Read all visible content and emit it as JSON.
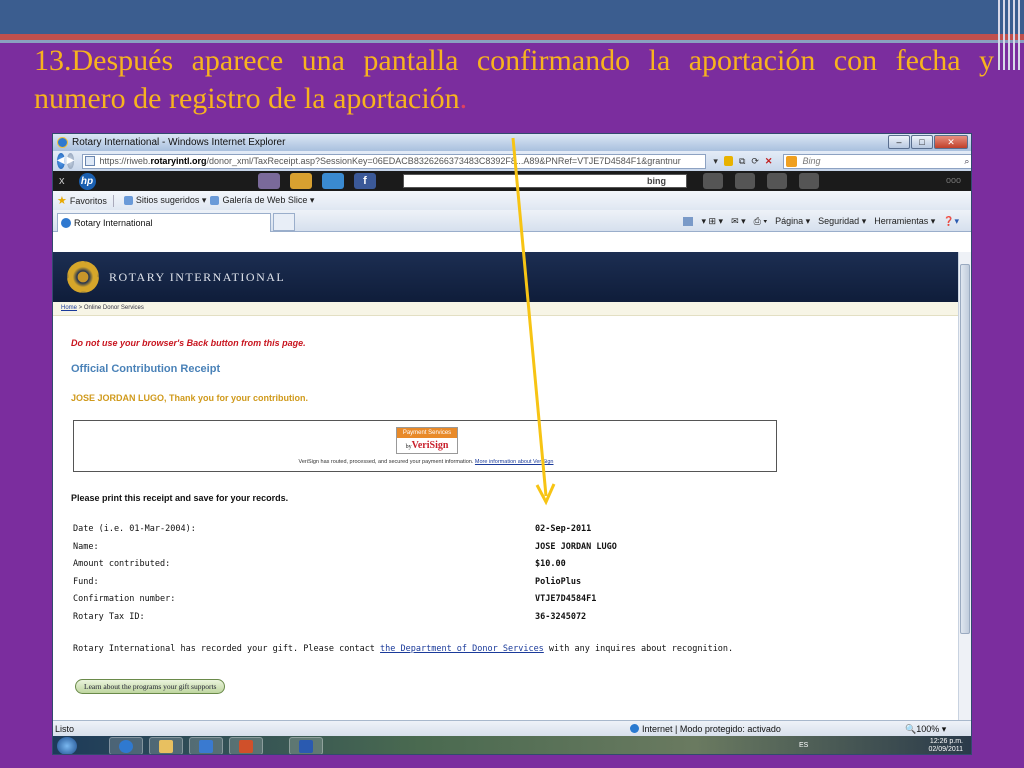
{
  "slide": {
    "title": "13.Después aparece una pantalla confirmando la aportación con fecha y numero de registro de la aportación",
    "title_end": ".",
    "colors": {
      "background": "#7b2d9e",
      "title": "#f7b31e",
      "arrow": "#f7c414"
    }
  },
  "browser": {
    "window_title": "Rotary International - Windows Internet Explorer",
    "url_prefix": "https://riweb.",
    "url_domain": "rotaryintl.org",
    "url_rest": "/donor_xml/TaxReceipt.asp?SessionKey=06EDACB8326266373483C8392F8...A89&PNRef=VTJE7D4584F1&grantnur",
    "search_placeholder": "Bing",
    "toolbar_search_brand": "bing",
    "tb_dots": "ooo",
    "favorites_label": "Favoritos",
    "fav_item_1": "Sitios sugeridos ▾",
    "fav_item_2": "Galería de Web Slice ▾",
    "tab_label": "Rotary International",
    "cmd_page": "Página ▾",
    "cmd_security": "Seguridad ▾",
    "cmd_tools": "Herramientas ▾",
    "status": "Listo",
    "zone": "Internet | Modo protegido: activado",
    "zoom": "100%",
    "clock_time": "12:26 p.m.",
    "clock_date": "02/09/2011",
    "lang": "ES"
  },
  "page": {
    "org_name": "ROTARY INTERNATIONAL",
    "crumb_home": "Home",
    "crumb_rest": " > Online Donor Services",
    "warning": "Do not use your browser's Back button from this page.",
    "receipt_title": "Official Contribution Receipt",
    "thanks": "JOSE JORDAN LUGO, Thank you for your contribution.",
    "verisign_badge_top": "Payment Services",
    "verisign_badge_by": "by",
    "verisign_badge_name": "VeriSign",
    "verisign_text": "VeriSign has routed, processed, and secured your payment information.",
    "verisign_link": "More information about VeriSign",
    "print_note": "Please print this receipt and save for your records.",
    "rows": [
      {
        "label": "Date (i.e. 01-Mar-2004):",
        "value": "02-Sep-2011"
      },
      {
        "label": "Name:",
        "value": "JOSE JORDAN LUGO"
      },
      {
        "label": "Amount contributed:",
        "value": "$10.00"
      },
      {
        "label": "Fund:",
        "value": "PolioPlus"
      },
      {
        "label": "Confirmation number:",
        "value": "VTJE7D4584F1"
      },
      {
        "label": "Rotary Tax ID:",
        "value": "36-3245072"
      }
    ],
    "recorded_pre": "Rotary International has recorded your gift. Please contact ",
    "recorded_link": "the Department of Donor Services",
    "recorded_post": " with any inquires about recognition.",
    "learn_button": "Learn about the programs your gift supports"
  }
}
